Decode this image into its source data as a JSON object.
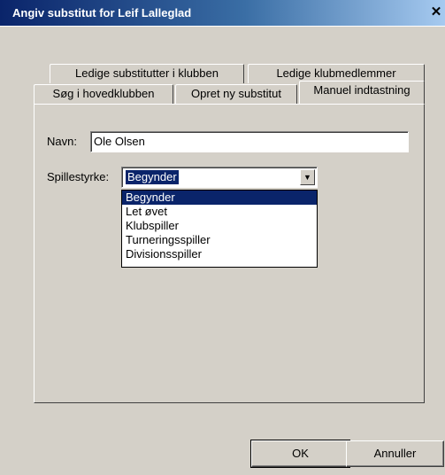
{
  "window": {
    "title": "Angiv substitut for Leif Lalleglad",
    "close_glyph": "✕"
  },
  "tabs": {
    "back_row": [
      "Ledige substitutter i klubben",
      "Ledige klubmedlemmer"
    ],
    "front_row": [
      "Søg i hovedklubben",
      "Opret ny substitut",
      "Manuel indtastning"
    ],
    "active": "Manuel indtastning"
  },
  "form": {
    "name_label": "Navn:",
    "name_value": "Ole Olsen",
    "strength_label": "Spillestyrke:",
    "strength_value": "Begynder",
    "options": [
      "Begynder",
      "Let øvet",
      "Klubspiller",
      "Turneringsspiller",
      "Divisionsspiller"
    ]
  },
  "buttons": {
    "ok": "OK",
    "cancel": "Annuller"
  }
}
